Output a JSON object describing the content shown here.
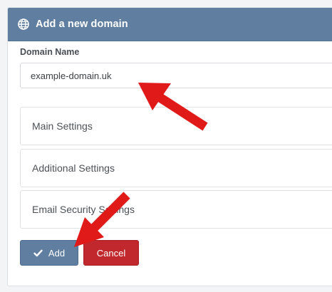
{
  "header": {
    "title": "Add a new domain",
    "icon": "globe-icon"
  },
  "form": {
    "domain_label": "Domain Name",
    "domain_value": "example-domain.uk"
  },
  "sections": [
    {
      "label": "Main Settings"
    },
    {
      "label": "Additional Settings"
    },
    {
      "label": "Email Security Settings"
    }
  ],
  "buttons": {
    "add_label": "Add",
    "cancel_label": "Cancel"
  },
  "colors": {
    "header": "#5f7ea0",
    "add_button": "#5f7ea0",
    "cancel_button": "#c0282d",
    "annotation_arrow": "#e01919"
  },
  "annotations": {
    "arrow_count": 2,
    "arrow_icon": "red-arrow-icon"
  }
}
